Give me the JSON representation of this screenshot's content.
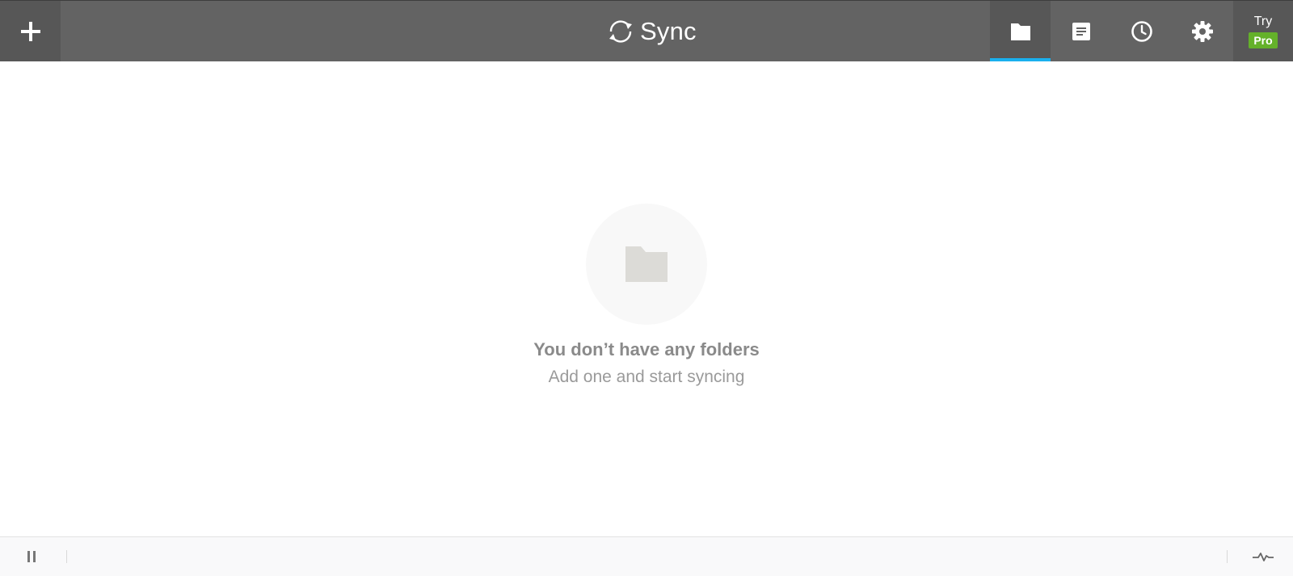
{
  "header": {
    "add_icon": "plus-icon",
    "brand_icon": "sync-arrows-icon",
    "brand_title": "Sync",
    "nav": [
      {
        "icon": "folder-icon",
        "name": "Folders",
        "active": true
      },
      {
        "icon": "document-icon",
        "name": "Transfers",
        "active": false
      },
      {
        "icon": "clock-icon",
        "name": "History",
        "active": false
      },
      {
        "icon": "gear-icon",
        "name": "Preferences",
        "active": false
      }
    ],
    "try_label": "Try",
    "pro_label": "Pro"
  },
  "empty_state": {
    "icon": "folder-icon",
    "title": "You don’t have any folders",
    "subtitle": "Add one and start syncing"
  },
  "statusbar": {
    "pause_icon": "pause-icon",
    "activity_icon": "activity-pulse-icon"
  },
  "colors": {
    "header_bg": "#636363",
    "header_dark": "#575757",
    "active_tab_accent": "#1ab0ee",
    "pro_badge": "#64b12a",
    "empty_text": "#8a8a8a"
  }
}
